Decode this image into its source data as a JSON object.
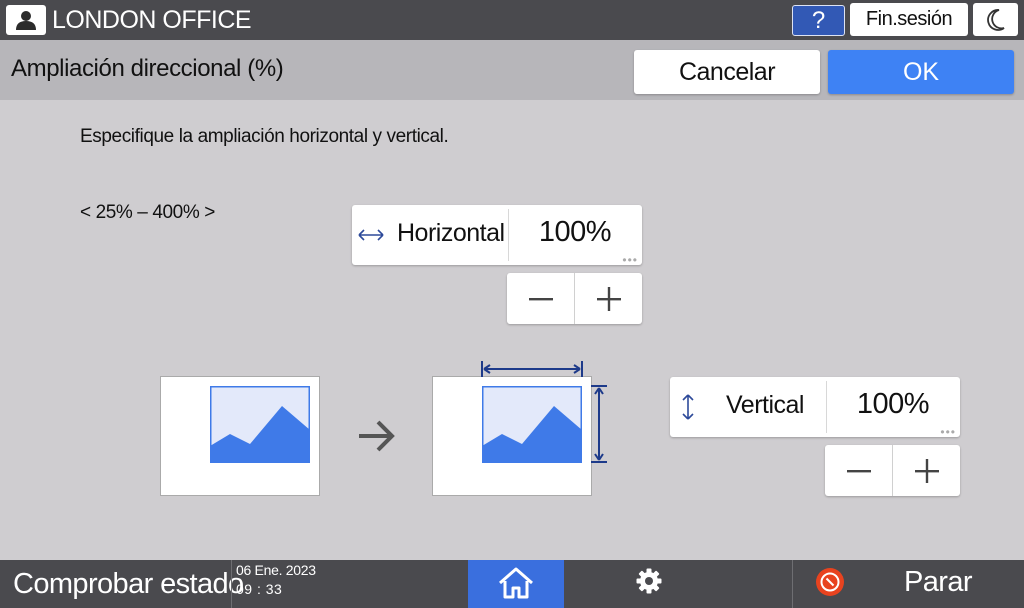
{
  "header": {
    "office_name": "LONDON OFFICE",
    "help_label": "?",
    "logout_label": "Fin.sesión"
  },
  "titlebar": {
    "title": "Ampliación direccional (%)",
    "cancel_label": "Cancelar",
    "ok_label": "OK"
  },
  "main": {
    "instruction": "Especifique la ampliación horizontal y vertical.",
    "range": "< 25% – 400% >",
    "horizontal": {
      "icon": "horizontal-arrows-icon",
      "label": "Horizontal",
      "value": "100%"
    },
    "vertical": {
      "icon": "vertical-arrows-icon",
      "label": "Vertical",
      "value": "100%"
    }
  },
  "footer": {
    "status_label": "Comprobar estado",
    "date": "06 Ene. 2023",
    "time": "09 : 33",
    "stop_label": "Parar"
  },
  "colors": {
    "accent": "#3e82f4",
    "topbar": "#4a4a4e",
    "image_blue": "#3f7ae8",
    "image_light": "#e3e9fa",
    "dimension_lines": "#1d3a8a",
    "stop_red": "#e8431f"
  }
}
